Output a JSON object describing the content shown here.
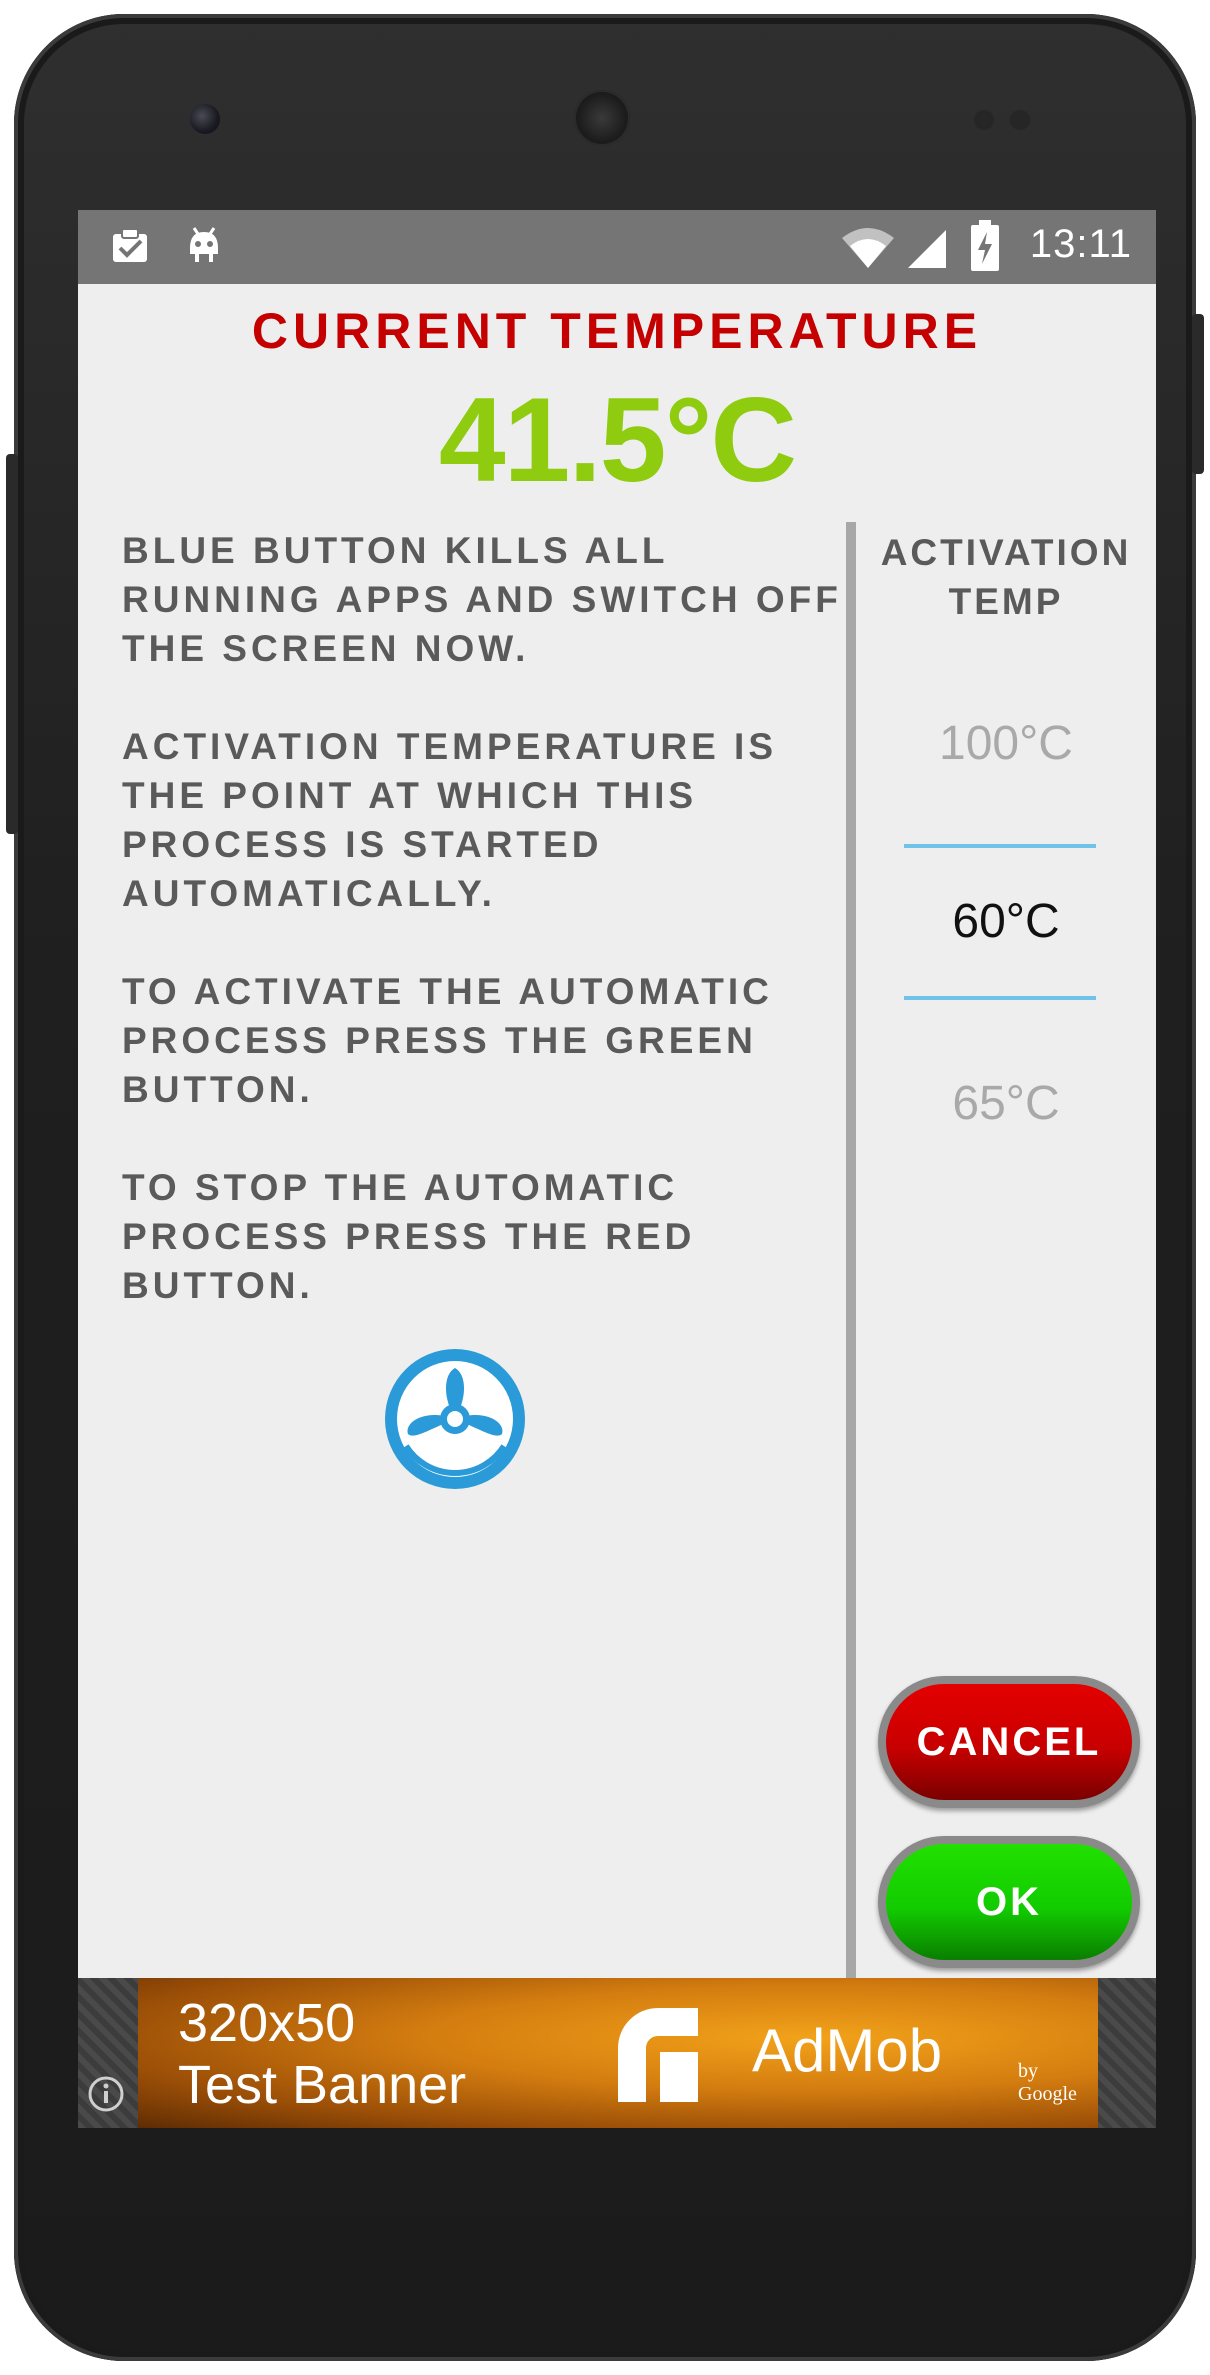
{
  "status_bar": {
    "time": "13:11",
    "icons": [
      "clipboard-check-icon",
      "android-debug-icon",
      "wifi-icon",
      "cell-signal-icon",
      "battery-charging-icon"
    ]
  },
  "header": {
    "title": "Current Temperature",
    "current_temp": "41.5°C"
  },
  "description": {
    "paragraphs": [
      "Blue button kills all running apps and switch off the screen now.",
      "Activation temperature is the point at which this process is started automatically.",
      "To activate the automatic process press the green button.",
      "To stop the automatic process press the red button."
    ]
  },
  "activation": {
    "label_line1": "Activation",
    "label_line2": "Temp",
    "options": [
      "100°C",
      "60°C",
      "65°C"
    ],
    "selected": "60°C"
  },
  "buttons": {
    "cancel": "Cancel",
    "ok": "OK",
    "kill_apps": "fan-icon"
  },
  "ad": {
    "line1": "320x50",
    "line2": "Test Banner",
    "brand": "AdMob",
    "brand_by": "by Google"
  },
  "colors": {
    "title": "#c40000",
    "temperature": "#8fcc10",
    "cancel": "#d00000",
    "ok": "#14cc00",
    "picker_line": "#6fc3e8",
    "fan": "#2a9ad8"
  }
}
